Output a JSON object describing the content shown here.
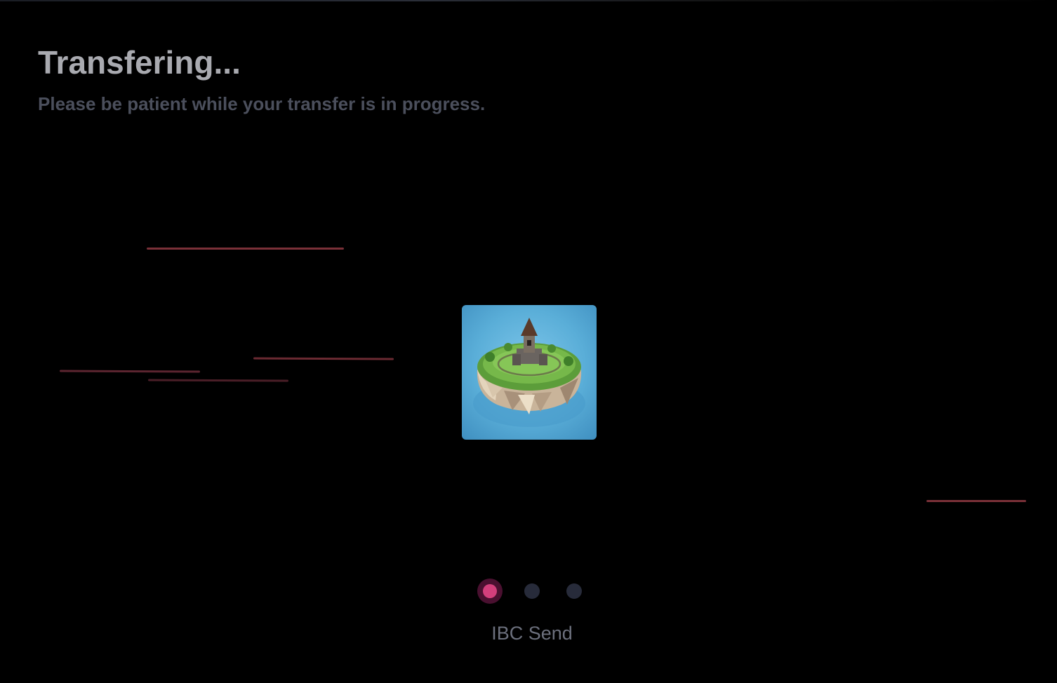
{
  "header": {
    "title": "Transfering...",
    "subtitle": "Please be patient while your transfer is in progress."
  },
  "animation": {
    "image": "island-icon",
    "streak_color": "#7a3038"
  },
  "progress": {
    "steps_total": 3,
    "current_step": 1,
    "current_step_label": "IBC Send",
    "active_color": "#d23f7c",
    "inactive_color": "#272b3a"
  }
}
